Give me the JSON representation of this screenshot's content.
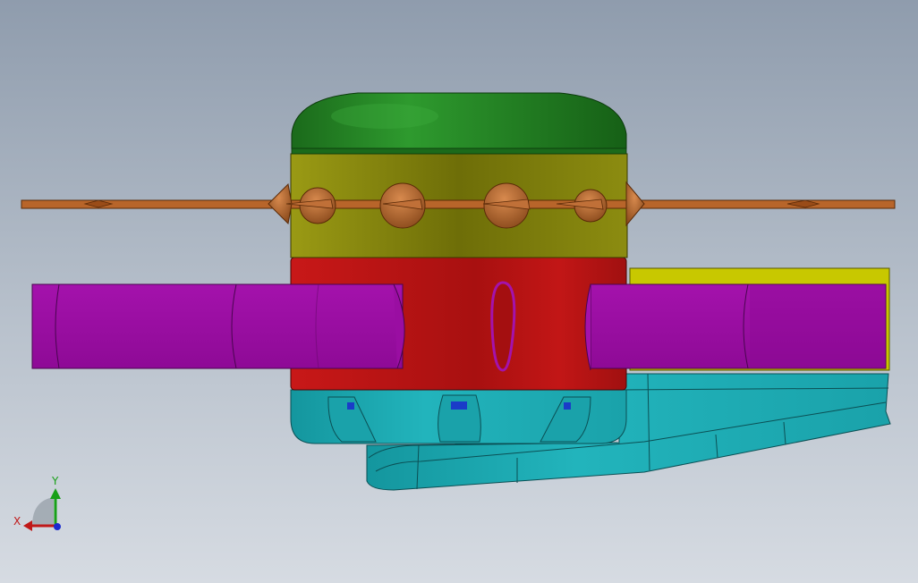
{
  "viewport": {
    "background_top": "#8f9cad",
    "background_bottom": "#d6dbe2"
  },
  "model": {
    "parts": [
      {
        "name": "dome-cap",
        "color": "#1f7a1f"
      },
      {
        "name": "upper-band",
        "color": "#8a8a10"
      },
      {
        "name": "middle-band",
        "color": "#b51414"
      },
      {
        "name": "side-cylinders",
        "color": "#a010a8"
      },
      {
        "name": "yellow-bar",
        "color": "#c8c800"
      },
      {
        "name": "cyan-base",
        "color": "#20a8b0"
      },
      {
        "name": "spokes",
        "color": "#b8652a"
      },
      {
        "name": "blue-inserts",
        "color": "#1a3cc8"
      }
    ]
  },
  "triad": {
    "x_label": "X",
    "y_label": "Y",
    "x_color": "#c01818",
    "y_color": "#18a018",
    "z_color": "#1a2ad0"
  }
}
